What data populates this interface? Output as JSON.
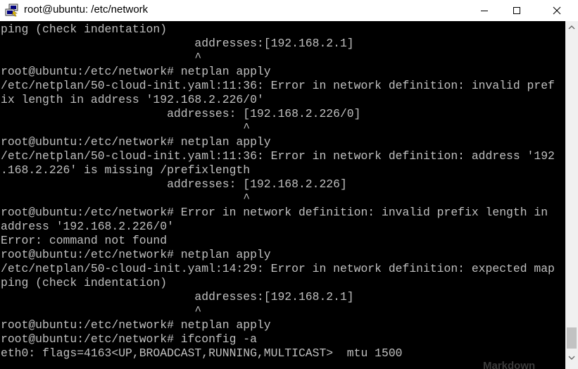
{
  "window": {
    "title": "root@ubuntu: /etc/network",
    "app_icon": "putty-icon",
    "controls": {
      "minimize_icon": "minimize-icon",
      "maximize_icon": "maximize-icon",
      "close_icon": "close-icon"
    }
  },
  "terminal": {
    "lines": [
      "ping (check indentation)",
      "                            addresses:[192.168.2.1]",
      "                            ^",
      "root@ubuntu:/etc/network# netplan apply",
      "/etc/netplan/50-cloud-init.yaml:11:36: Error in network definition: invalid pref",
      "ix length in address '192.168.2.226/0'",
      "                        addresses: [192.168.2.226/0]",
      "                                   ^",
      "root@ubuntu:/etc/network# netplan apply",
      "/etc/netplan/50-cloud-init.yaml:11:36: Error in network definition: address '192",
      ".168.2.226' is missing /prefixlength",
      "                        addresses: [192.168.2.226]",
      "                                   ^",
      "root@ubuntu:/etc/network# Error in network definition: invalid prefix length in",
      "address '192.168.2.226/0'",
      "Error: command not found",
      "root@ubuntu:/etc/network# netplan apply",
      "/etc/netplan/50-cloud-init.yaml:14:29: Error in network definition: expected map",
      "ping (check indentation)",
      "                            addresses:[192.168.2.1]",
      "                            ^",
      "root@ubuntu:/etc/network# netplan apply",
      "root@ubuntu:/etc/network# ifconfig -a",
      "eth0: flags=4163<UP,BROADCAST,RUNNING,MULTICAST>  mtu 1500"
    ],
    "scrollbar": {
      "up_icon": "scroll-up-arrow-icon",
      "down_icon": "scroll-down-arrow-icon"
    }
  },
  "background_window": {
    "partial_text": "Markdown"
  },
  "colors": {
    "terminal_bg": "#000000",
    "terminal_fg": "#c0c0c0",
    "titlebar_bg": "#ffffff"
  }
}
